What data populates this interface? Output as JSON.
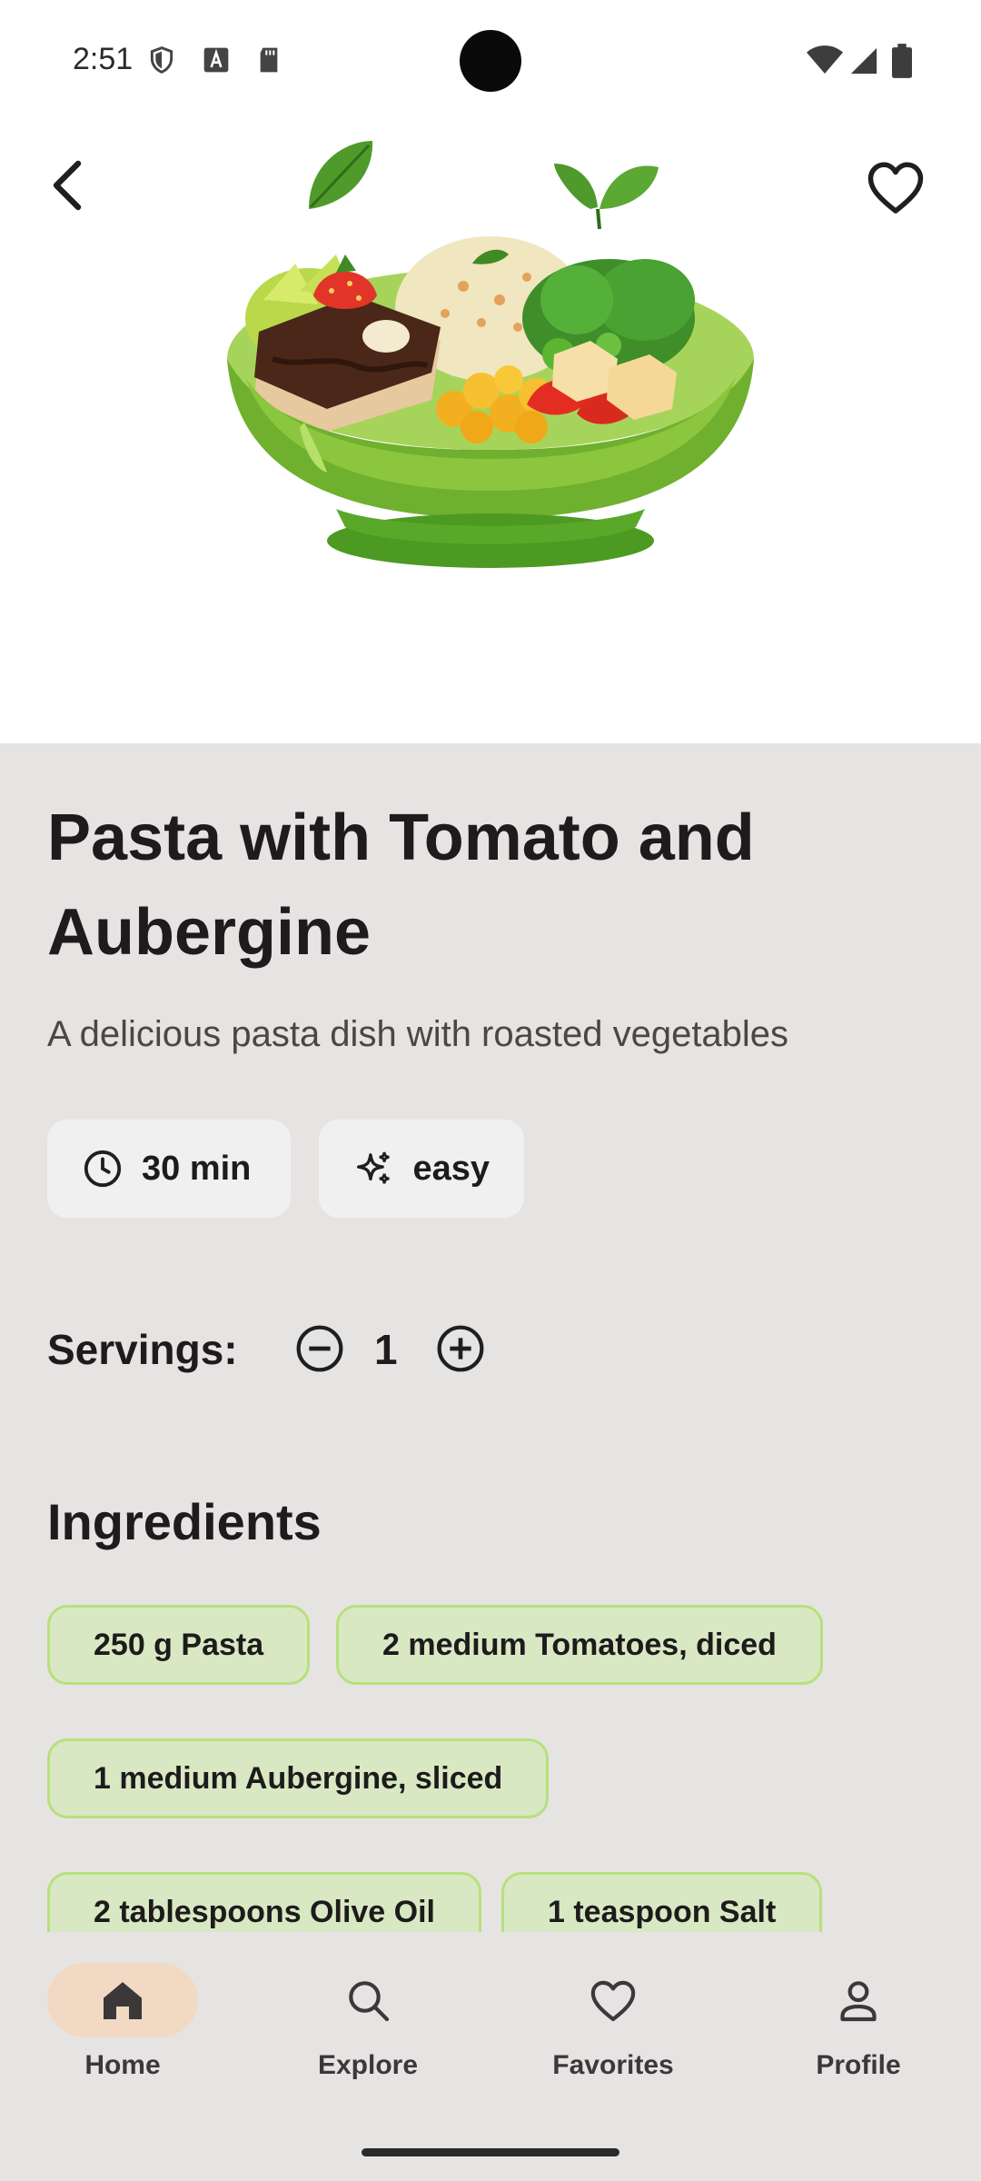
{
  "status_bar": {
    "time": "2:51"
  },
  "recipe": {
    "title": "Pasta with Tomato and Aubergine",
    "description": "A delicious pasta dish with roasted vegetables",
    "time": "30 min",
    "difficulty": "easy"
  },
  "servings": {
    "label": "Servings:",
    "value": "1"
  },
  "ingredients": {
    "title": "Ingredients",
    "items": [
      "250 g Pasta",
      "2 medium Tomatoes, diced",
      "1 medium Aubergine, sliced",
      "2 tablespoons Olive Oil",
      "1 teaspoon Salt"
    ]
  },
  "nav": {
    "items": [
      {
        "label": "Home",
        "icon": "home-icon",
        "active": true
      },
      {
        "label": "Explore",
        "icon": "search-icon",
        "active": false
      },
      {
        "label": "Favorites",
        "icon": "heart-icon",
        "active": false
      },
      {
        "label": "Profile",
        "icon": "person-icon",
        "active": false
      }
    ]
  },
  "colors": {
    "background": "#e6e4e3",
    "chip": "#f1f0f0",
    "ingredient_chip": "#d8e8c3",
    "ingredient_border": "#b7e07c",
    "nav_active": "#f1d9c3"
  }
}
